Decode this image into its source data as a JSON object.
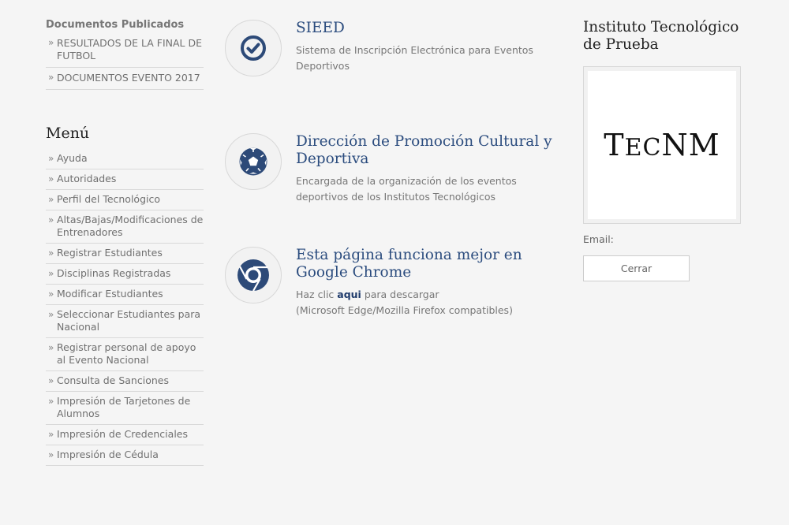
{
  "documents": {
    "title": "Documentos Publicados",
    "items": [
      "RESULTADOS DE LA FINAL DE FUTBOL",
      "DOCUMENTOS EVENTO 2017"
    ]
  },
  "menu": {
    "title": "Menú",
    "items": [
      "Ayuda",
      "Autoridades",
      "Perfil del Tecnológico",
      "Altas/Bajas/Modificaciones de Entrenadores",
      "Registrar Estudiantes",
      "Disciplinas Registradas",
      "Modificar Estudiantes",
      "Seleccionar Estudiantes para Nacional",
      "Registrar personal de apoyo al Evento Nacional",
      "Consulta de Sanciones",
      "Impresión de Tarjetones de Alumnos",
      "Impresión de Credenciales",
      "Impresión de Cédula"
    ]
  },
  "features": [
    {
      "icon": "check-icon",
      "title": "SIEED",
      "description": "Sistema de Inscripción Electrónica para Eventos Deportivos"
    },
    {
      "icon": "soccer-ball-icon",
      "title": "Dirección de Promoción Cultural y Deportiva",
      "description": "Encargada de la organización de los eventos deportivos de los Institutos Tecnológicos"
    },
    {
      "icon": "chrome-icon",
      "title": "Esta página funciona mejor en Google Chrome",
      "description_prefix": "Haz clic ",
      "description_link": "aqui",
      "description_suffix": " para descargar",
      "description_line2": "(Microsoft Edge/Mozilla Firefox compatibles)"
    }
  ],
  "sidebar_right": {
    "institute_title": "Instituto Tecnológico de Prueba",
    "logo_text": "TecNM",
    "email_label": "Email:",
    "close_button": "Cerrar"
  },
  "colors": {
    "accent": "#2b4c7e",
    "icon": "#2d4a78",
    "background": "#f5f5f5"
  }
}
